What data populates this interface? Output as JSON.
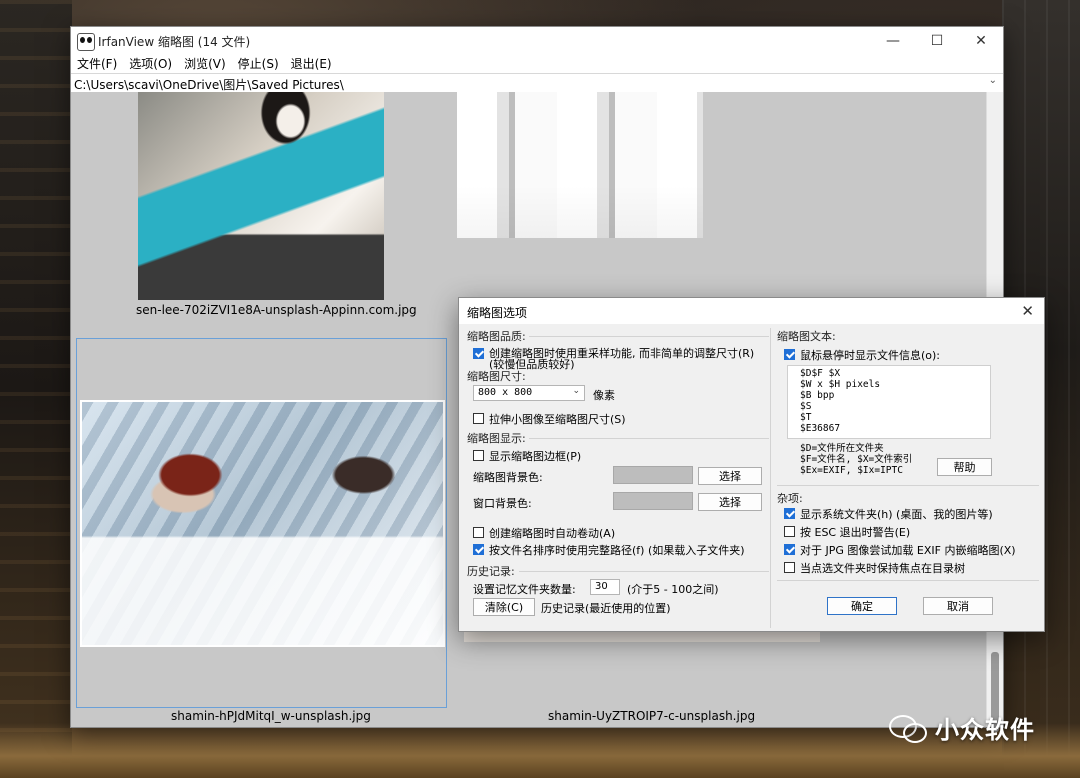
{
  "window": {
    "title": "IrfanView 缩略图 (14 文件)",
    "controls": {
      "minimize": "—",
      "maximize": "☐",
      "close": "✕"
    },
    "menu": [
      "文件(F)",
      "选项(O)",
      "浏览(V)",
      "停止(S)",
      "退出(E)"
    ],
    "path": "C:\\Users\\scavi\\OneDrive\\图片\\Saved Pictures\\"
  },
  "thumbnails": [
    {
      "caption": "sen-lee-702iZVI1e8A-unsplash-Appinn.com.jpg"
    },
    {
      "caption": ""
    },
    {
      "caption": "shamin-hPJdMitqI_w-unsplash.jpg"
    },
    {
      "caption": "shamin-UyZTROIP7-c-unsplash.jpg"
    }
  ],
  "dialog": {
    "title": "缩略图选项",
    "left": {
      "quality_header": "缩略图品质:",
      "resample_line1": "创建缩略图时使用重采样功能, 而非简单的调整尺寸(R)",
      "resample_line2": "(较慢但品质较好)",
      "resample_checked": true,
      "size_header": "缩略图尺寸:",
      "size_value": "800 x 800",
      "size_unit": "像素",
      "stretch_label": "拉伸小图像至缩略图尺寸(S)",
      "stretch_checked": false,
      "display_header": "缩略图显示:",
      "border_label": "显示缩略图边框(P)",
      "border_checked": false,
      "thumb_bg_label": "缩略图背景色:",
      "window_bg_label": "窗口背景色:",
      "choose_label": "选择",
      "autoscroll_label": "创建缩略图时自动卷动(A)",
      "autoscroll_checked": false,
      "fullpath_label": "按文件名排序时使用完整路径(f) (如果载入子文件夹)",
      "fullpath_checked": true,
      "history_header": "历史记录:",
      "history_count_label": "设置记忆文件夹数量:",
      "history_count": "30",
      "history_range": "(介于5 - 100之间)",
      "clear_label": "清除(C)",
      "history_desc": "历史记录(最近使用的位置)"
    },
    "right": {
      "text_header": "缩略图文本:",
      "hover_label": "鼠标悬停时显示文件信息(o):",
      "hover_checked": true,
      "memo_lines": [
        "$D$F $X",
        "$W x $H pixels",
        "$B bpp",
        "$S",
        "$T",
        "$E36867"
      ],
      "legend1": "$D=文件所在文件夹",
      "legend2": "$F=文件名, $X=文件索引",
      "legend3": "$Ex=EXIF, $Ix=IPTC",
      "help_label": "帮助",
      "misc_header": "杂项:",
      "sysfolders_label": "显示系统文件夹(h) (桌面、我的图片等)",
      "sysfolders_checked": true,
      "esc_label": "按 ESC 退出时警告(E)",
      "esc_checked": false,
      "exif_label": "对于 JPG 图像尝试加载 EXIF 内嵌缩略图(X)",
      "exif_checked": true,
      "focus_label": "当点选文件夹时保持焦点在目录树",
      "focus_checked": false,
      "ok_label": "确定",
      "cancel_label": "取消"
    }
  },
  "watermark": {
    "text": "小众软件"
  }
}
